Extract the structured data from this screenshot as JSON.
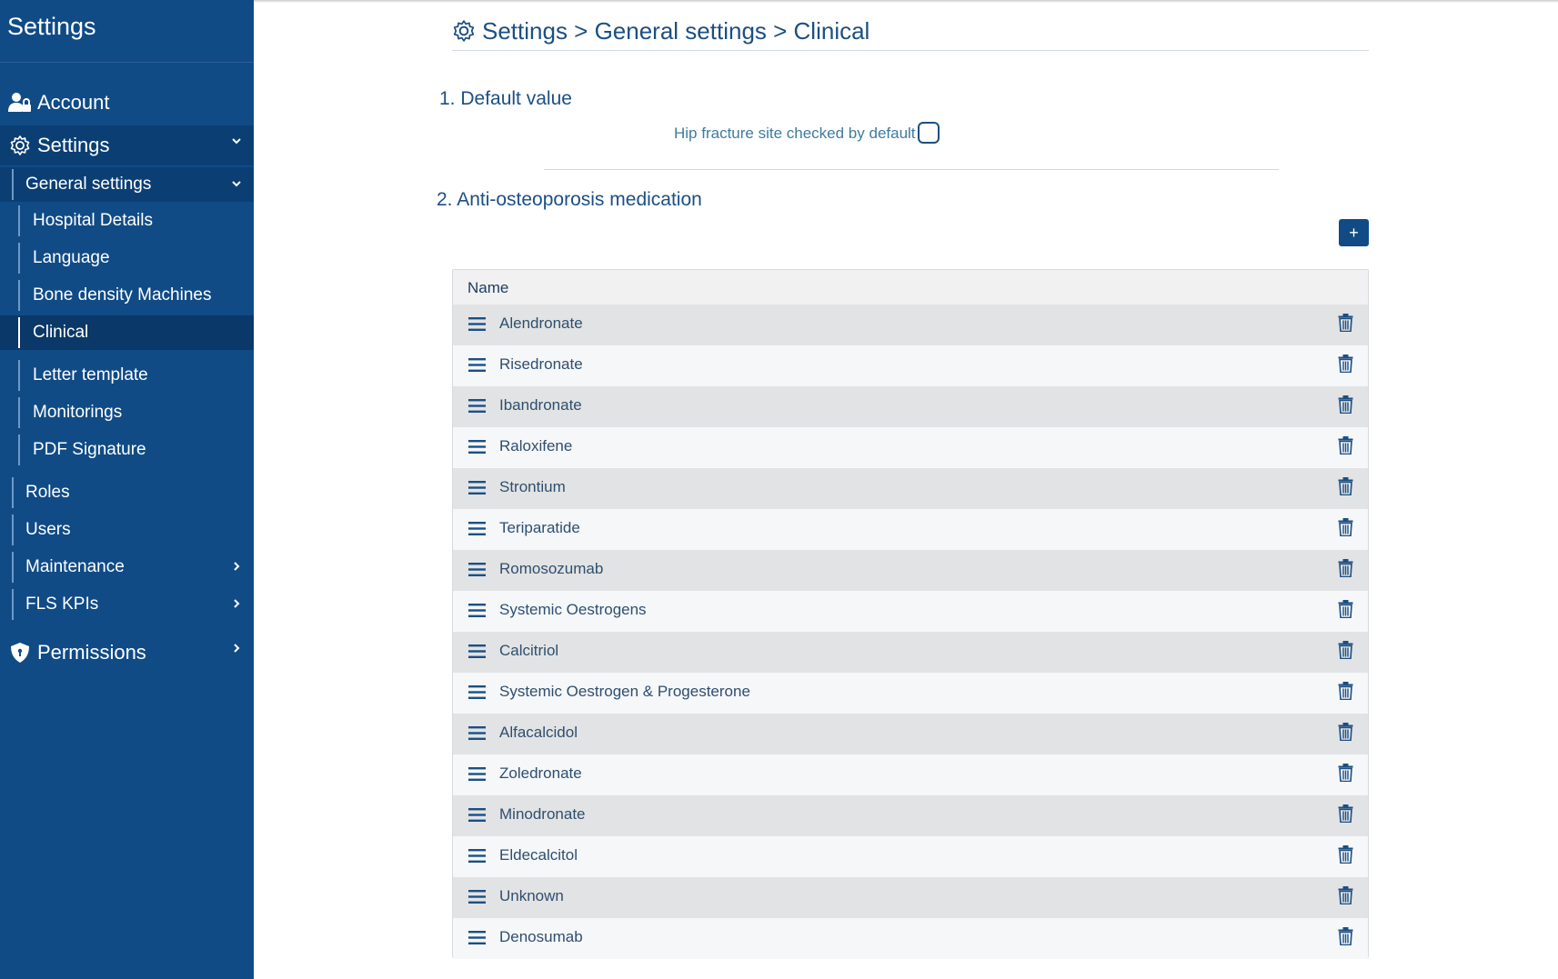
{
  "sidebar": {
    "title": "Settings",
    "account_label": "Account",
    "settings_label": "Settings",
    "general_settings_label": "General settings",
    "general_items": [
      {
        "label": "Hospital Details"
      },
      {
        "label": "Language"
      },
      {
        "label": "Bone density Machines"
      },
      {
        "label": "Clinical"
      },
      {
        "label": "Letter template"
      },
      {
        "label": "Monitorings"
      },
      {
        "label": "PDF Signature"
      }
    ],
    "roles_label": "Roles",
    "users_label": "Users",
    "maintenance_label": "Maintenance",
    "fls_kpis_label": "FLS KPIs",
    "permissions_label": "Permissions"
  },
  "breadcrumb": {
    "text": "Settings > General settings > Clinical"
  },
  "section1": {
    "title": "1. Default value",
    "hip_label": "Hip fracture site checked by default",
    "hip_checked": false
  },
  "section2": {
    "title": "2. Anti-osteoporosis medication",
    "add_label": "+",
    "column_name": "Name",
    "medications": [
      "Alendronate",
      "Risedronate",
      "Ibandronate",
      "Raloxifene",
      "Strontium",
      "Teriparatide",
      "Romosozumab",
      "Systemic Oestrogens",
      "Calcitriol",
      "Systemic Oestrogen & Progesterone",
      "Alfacalcidol",
      "Zoledronate",
      "Minodronate",
      "Eldecalcitol",
      "Unknown",
      "Denosumab"
    ]
  },
  "colors": {
    "sidebar_bg": "#104b86",
    "accent": "#1c4f83",
    "row_odd": "#e2e3e4",
    "row_even": "#f5f7f9"
  }
}
